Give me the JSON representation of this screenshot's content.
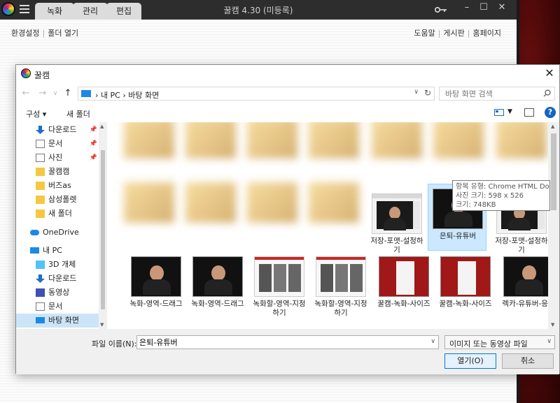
{
  "app": {
    "title": "꿀캠 4.30 (미등록)",
    "tabs": [
      "녹화",
      "관리",
      "편집"
    ],
    "toolbar_left": [
      "환경설정",
      "폴더 열기"
    ],
    "toolbar_right": [
      "도움말",
      "게시판",
      "홈페이지"
    ]
  },
  "dialog": {
    "title": "꿀캠",
    "breadcrumb": "›  내 PC  ›  바탕 화면",
    "search_placeholder": "바탕 화면 검색",
    "organize": "구성 ▾",
    "new_folder": "새 폴더",
    "nav": [
      {
        "label": "다운로드",
        "icon": "download-icon",
        "pinned": true
      },
      {
        "label": "문서",
        "icon": "document-icon",
        "pinned": true
      },
      {
        "label": "사진",
        "icon": "picture-icon",
        "pinned": true
      },
      {
        "label": "꿀캠캠",
        "icon": "folder-icon",
        "pinned": false
      },
      {
        "label": "버즈as",
        "icon": "folder-icon",
        "pinned": false
      },
      {
        "label": "삼성폴렛",
        "icon": "folder-icon",
        "pinned": false
      },
      {
        "label": "새 폴더",
        "icon": "folder-icon",
        "pinned": false
      },
      {
        "label": "OneDrive",
        "icon": "cloud-icon",
        "pinned": false
      },
      {
        "label": "내 PC",
        "icon": "pc-icon",
        "pinned": false
      },
      {
        "label": "3D 개체",
        "icon": "cube-icon",
        "pinned": false
      },
      {
        "label": "다운로드",
        "icon": "download-icon",
        "pinned": false
      },
      {
        "label": "동영상",
        "icon": "video-icon",
        "pinned": false
      },
      {
        "label": "문서",
        "icon": "document-icon",
        "pinned": false
      },
      {
        "label": "바탕 화면",
        "icon": "desktop-icon",
        "pinned": false,
        "selected": true
      }
    ],
    "files_row2": [
      {
        "name": "저장-포맷-설정하기"
      },
      {
        "name": "은퇴-유튜버",
        "selected": true
      },
      {
        "name": "저장-포맷-설정하기"
      }
    ],
    "files_row3": [
      {
        "name": "녹화-영역-드래그"
      },
      {
        "name": "녹화-영역-드래그"
      },
      {
        "name": "녹화할-영역-지정하기"
      },
      {
        "name": "녹화할-영역-지정하기"
      },
      {
        "name": "꿀캠-녹화-사이즈"
      },
      {
        "name": "꿀캠-녹화-사이즈"
      },
      {
        "name": "렉카-유튜버-응짤"
      }
    ],
    "tooltip": {
      "line1": "항목 유형: Chrome HTML Do",
      "line2": "사진 크기: 598 x 526",
      "line3": "크기: 748KB"
    },
    "filename_label": "파일 이름(N):",
    "filename_value": "은퇴-유튜버",
    "filetype": "이미지 또는 동영상 파일",
    "open_button": "열기(O)",
    "cancel_button": "취소"
  }
}
